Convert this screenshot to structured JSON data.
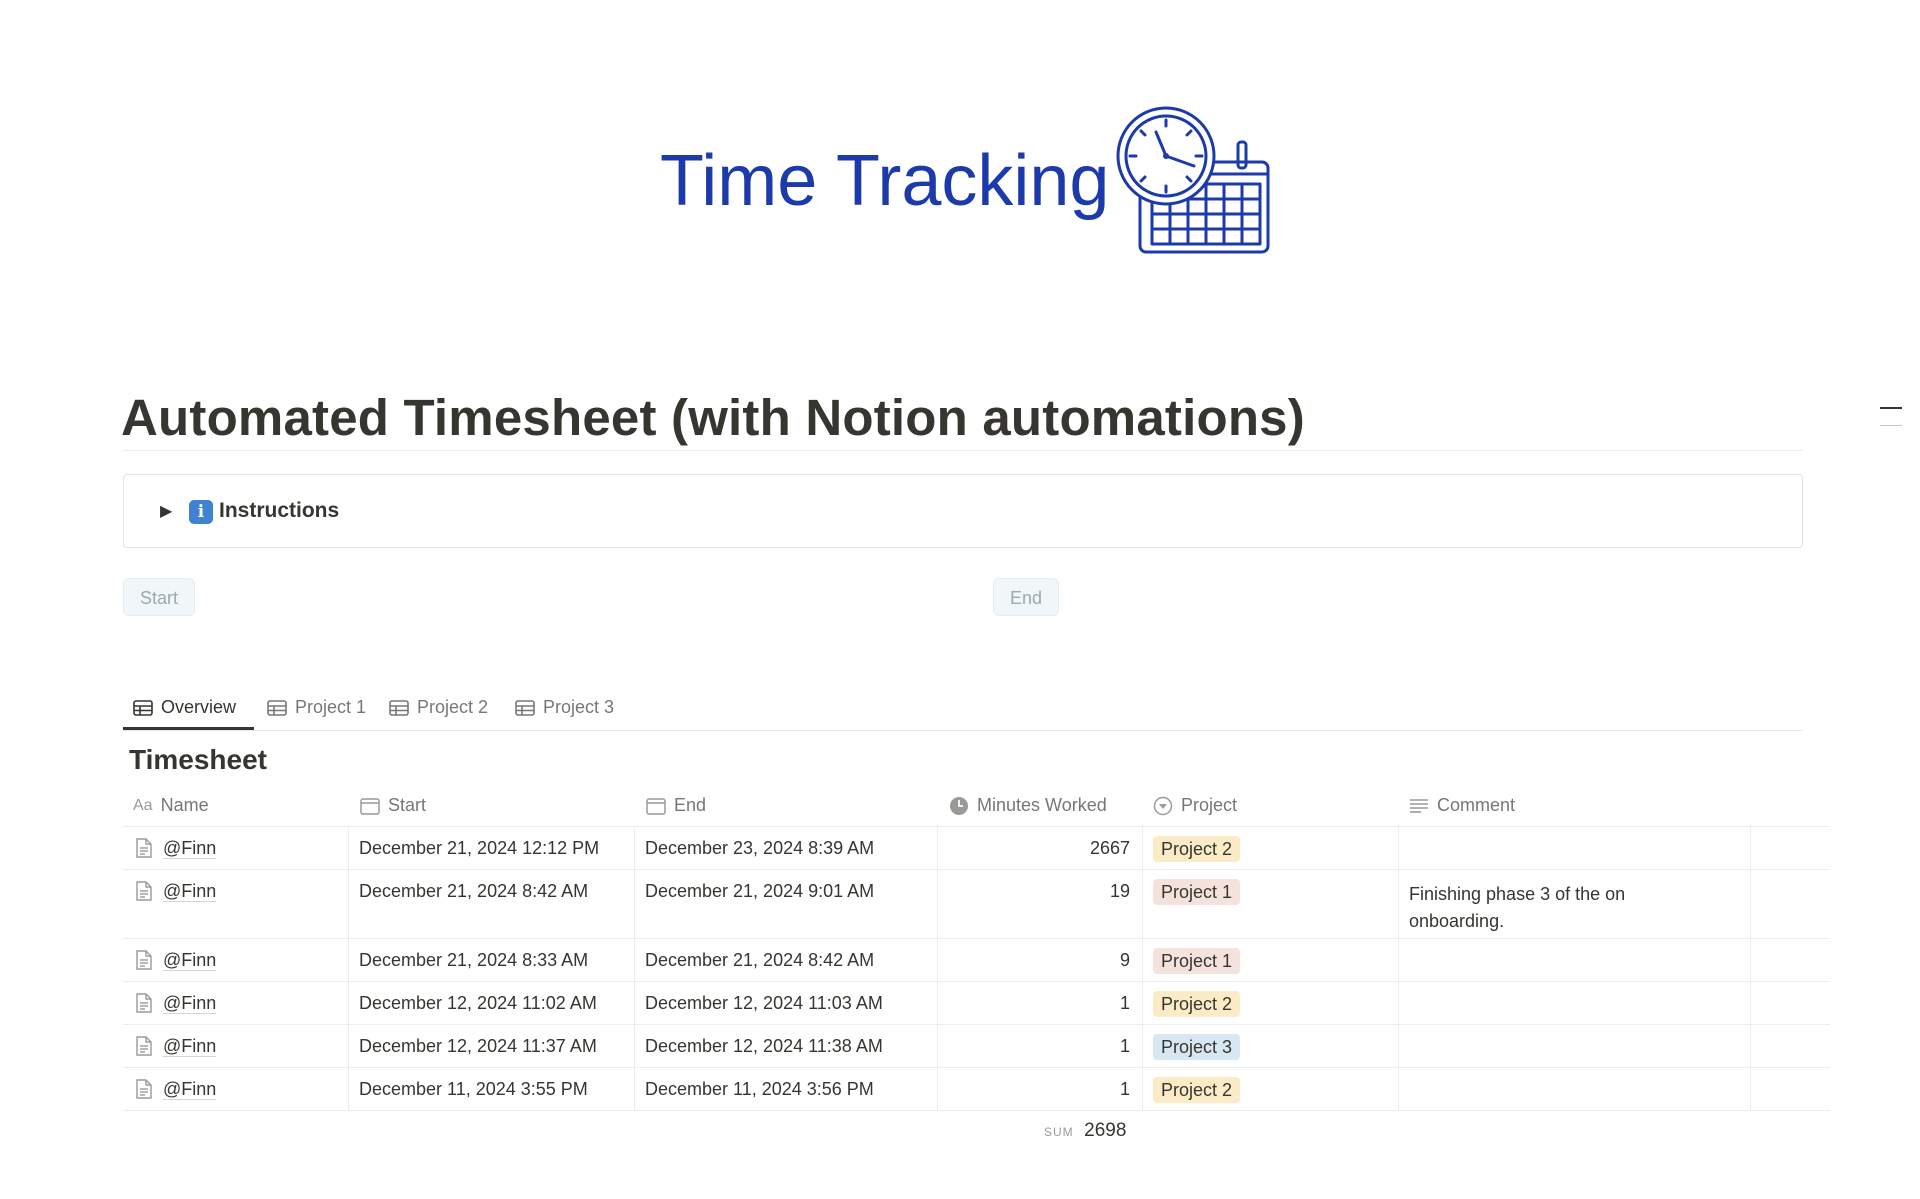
{
  "cover": {
    "title": "Time Tracking",
    "icon": "clock-calendar-icon",
    "accent": "#1c3aa9"
  },
  "page": {
    "title": "Automated Timesheet (with Notion automations)"
  },
  "toggle": {
    "icon": "information-icon",
    "icon_glyph": "i",
    "label": "Instructions"
  },
  "buttons": {
    "start_label": "Start",
    "end_label": "End"
  },
  "tabs": [
    {
      "label": "Overview",
      "icon": "table-icon",
      "active": true
    },
    {
      "label": "Project 1",
      "icon": "table-icon",
      "active": false
    },
    {
      "label": "Project 2",
      "icon": "table-icon",
      "active": false
    },
    {
      "label": "Project 3",
      "icon": "table-icon",
      "active": false
    }
  ],
  "database": {
    "title": "Timesheet",
    "name_icon_text": "Aa",
    "columns": {
      "name": "Name",
      "start": "Start",
      "end": "End",
      "minutes": "Minutes Worked",
      "project": "Project",
      "comment": "Comment"
    },
    "rows": [
      {
        "name": "@Finn",
        "start": "December 21, 2024 12:12 PM",
        "end": "December 23, 2024 8:39 AM",
        "minutes": "2667",
        "project": "Project 2",
        "comment": ""
      },
      {
        "name": "@Finn",
        "start": "December 21, 2024 8:42 AM",
        "end": "December 21, 2024 9:01 AM",
        "minutes": "19",
        "project": "Project 1",
        "comment": "Finishing phase 3 of the on onboarding."
      },
      {
        "name": "@Finn",
        "start": "December 21, 2024 8:33 AM",
        "end": "December 21, 2024 8:42 AM",
        "minutes": "9",
        "project": "Project 1",
        "comment": ""
      },
      {
        "name": "@Finn",
        "start": "December 12, 2024 11:02 AM",
        "end": "December 12, 2024 11:03 AM",
        "minutes": "1",
        "project": "Project 2",
        "comment": ""
      },
      {
        "name": "@Finn",
        "start": "December 12, 2024 11:37 AM",
        "end": "December 12, 2024 11:38 AM",
        "minutes": "1",
        "project": "Project 3",
        "comment": ""
      },
      {
        "name": "@Finn",
        "start": "December 11, 2024 3:55 PM",
        "end": "December 11, 2024 3:56 PM",
        "minutes": "1",
        "project": "Project 2",
        "comment": ""
      }
    ],
    "project_colors": {
      "Project 1": "#f6e2dc",
      "Project 2": "#fbecc7",
      "Project 3": "#d8e8f3"
    },
    "sum_label": "SUM",
    "sum_value": "2698"
  }
}
